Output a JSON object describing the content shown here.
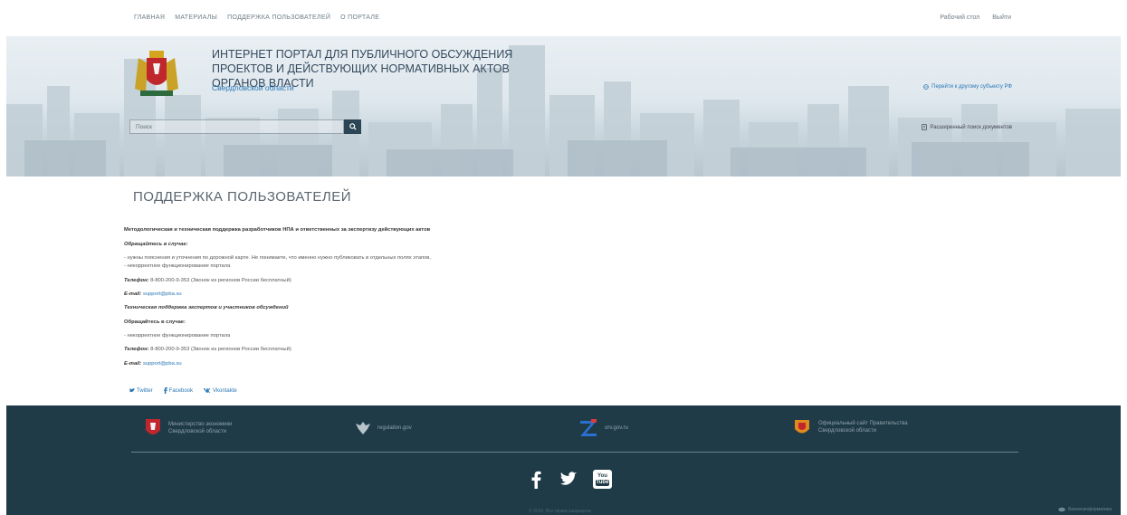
{
  "topnav": {
    "items": [
      "ГЛАВНАЯ",
      "МАТЕРИАЛЫ",
      "ПОДДЕРЖКА ПОЛЬЗОВАТЕЛЕЙ",
      "О ПОРТАЛЕ"
    ],
    "desktop": "Рабочий стол",
    "logout": "Выйти"
  },
  "header": {
    "title": "ИНТЕРНЕТ ПОРТАЛ ДЛЯ ПУБЛИЧНОГО ОБСУЖДЕНИЯ ПРОЕКТОВ И ДЕЙСТВУЮЩИХ НОРМАТИВНЫХ АКТОВ ОРГАНОВ ВЛАСТИ",
    "region": "Свердловской области",
    "other_subject": "Перейти к другому субъекту РФ",
    "search_placeholder": "Поиск",
    "advanced_search": "Расширенный поиск документов"
  },
  "page": {
    "title": "ПОДДЕРЖКА ПОЛЬЗОВАТЕЛЕЙ"
  },
  "support": {
    "heading1": "Методологическая и техническая поддержка разработчиков НПА и ответственных за экспертизу действующих актов",
    "contact_when1": "Обращайтесь в случае:",
    "item1a": "- нужны пояснения и уточнения по дорожной карте. Не понимаете, что именно нужно публиковать в отдельных полях этапов,",
    "item1b": "- некорректное функционирование портала",
    "phone_label1": "Телефон:",
    "phone1": "8-800-200-9-353 (Звонок из регионов России бесплатный)",
    "email_label1": "E-mail:",
    "email1": "support@pba.su",
    "heading2": "Техническая поддержка экспертов и участников обсуждений",
    "contact_when2": "Обращайтесь в случае:",
    "item2a": "- некорректное функционирование портала",
    "phone_label2": "Телефон:",
    "phone2": "8-800-200-9-353 (Звонок из регионов России бесплатный)",
    "email_label2": "E-mail:",
    "email2": "support@pba.su"
  },
  "social": {
    "twitter": "Twitter",
    "facebook": "Facebook",
    "vk": "Vkontakte"
  },
  "footer": {
    "ministry": [
      "Министерство экономики",
      "Свердловской области"
    ],
    "regulation": "regulation.gov",
    "orv": "orv.gov.ru",
    "government": [
      "Официальный сайт Правительства",
      "Свердловской области"
    ],
    "youtube_top": "You",
    "youtube_bottom": "Tube",
    "copyright": "© 2016. Все права защищены",
    "corner": "Бизнесинформатика"
  },
  "colors": {
    "accent": "#2a77b5",
    "footer_bg": "#1f3b47",
    "search_button": "#2c4655"
  },
  "icons": [
    "emblem-icon",
    "globe-icon",
    "search-icon",
    "document-search-icon",
    "twitter-icon",
    "facebook-icon",
    "vk-icon",
    "ministry-logo-icon",
    "eagle-icon",
    "orv-logo-icon",
    "government-logo-icon",
    "youtube-icon",
    "corner-logo-icon"
  ]
}
